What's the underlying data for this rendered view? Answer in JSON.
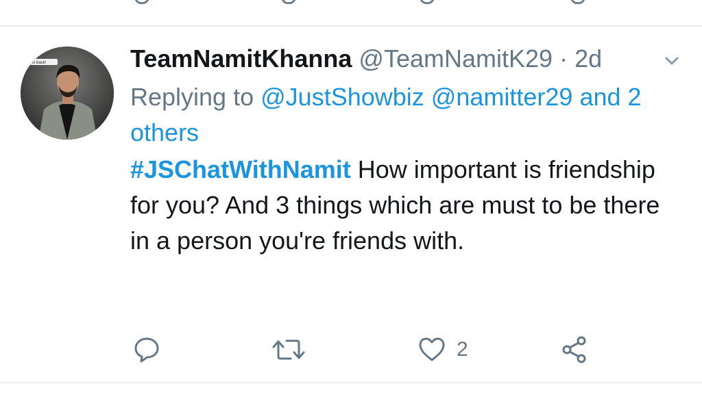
{
  "tweet": {
    "author_name": "TeamNamitKhanna",
    "author_handle": "@TeamNamitK29",
    "separator": "·",
    "time": "2d",
    "replying_prefix": "Replying to",
    "replying_handles": [
      "@JustShowbiz",
      "@namitter29"
    ],
    "replying_and": "and",
    "replying_others": "2 others",
    "hashtag": "#JSChatWithNamit",
    "text": " How important is friendship for you? And 3 things which are must to be there in a person you're friends with.",
    "avatar_badge_text": "is back!",
    "actions": {
      "reply_icon": "reply-icon",
      "retweet_icon": "retweet-icon",
      "like_icon": "heart-icon",
      "like_count": "2",
      "share_icon": "share-icon"
    }
  },
  "colors": {
    "link": "#1b95e0",
    "muted": "#657786",
    "text": "#14171a",
    "divider": "#e6ecf0"
  }
}
